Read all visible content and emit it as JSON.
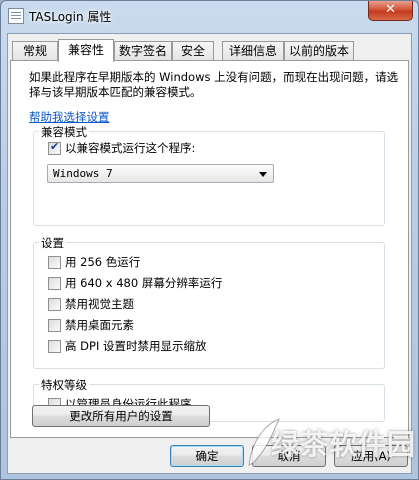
{
  "window": {
    "title": "TASLogin 属性",
    "close_label": "✕"
  },
  "tabs": [
    "常规",
    "兼容性",
    "数字签名",
    "安全",
    "详细信息",
    "以前的版本"
  ],
  "active_tab": 1,
  "intro": "如果此程序在早期版本的 Windows 上没有问题，而现在出现问题，请选择与该早期版本匹配的兼容模式。",
  "help_link": "帮助我选择设置",
  "compat": {
    "label": "兼容模式",
    "checkbox": {
      "label": "以兼容模式运行这个程序:",
      "checked": true
    },
    "select_value": "Windows 7"
  },
  "settings": {
    "label": "设置",
    "items": [
      {
        "label": "用 256 色运行",
        "checked": false
      },
      {
        "label": "用 640 x 480 屏幕分辨率运行",
        "checked": false
      },
      {
        "label": "禁用视觉主题",
        "checked": false
      },
      {
        "label": "禁用桌面元素",
        "checked": false
      },
      {
        "label": "高 DPI 设置时禁用显示缩放",
        "checked": false
      }
    ]
  },
  "privilege": {
    "label": "特权等级",
    "checkbox": {
      "label": "以管理员身份运行此程序",
      "checked": false
    }
  },
  "all_users_button": "更改所有用户的设置",
  "buttons": {
    "ok": "确定",
    "cancel": "取消",
    "apply": "应用(A)"
  },
  "watermark": "绿茶软件园"
}
